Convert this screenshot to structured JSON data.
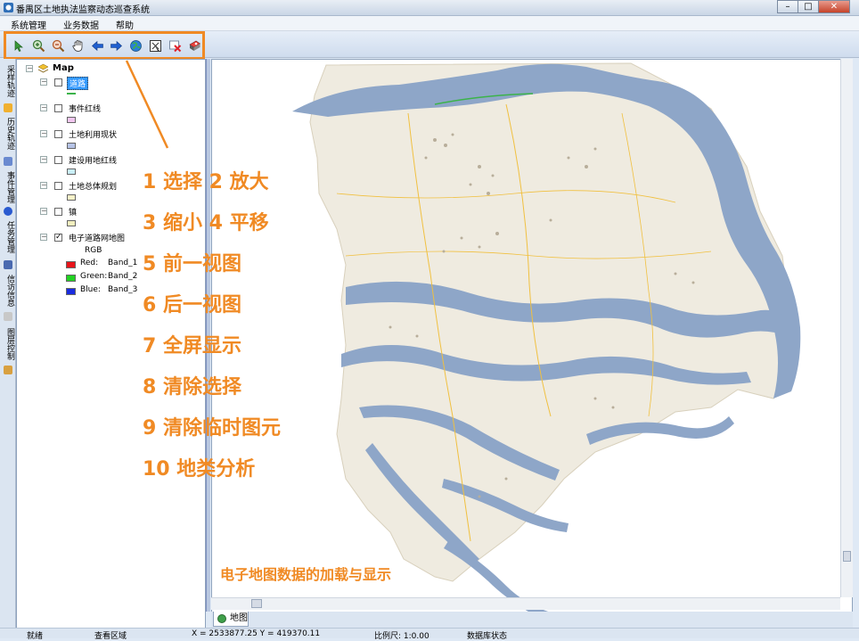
{
  "window": {
    "title": "番禺区土地执法监察动态巡查系统",
    "minimize": "–",
    "maximize": "□",
    "close": "✕"
  },
  "menu": [
    "系统管理",
    "业务数据",
    "帮助"
  ],
  "toolbar": [
    {
      "name": "select-tool-icon"
    },
    {
      "name": "zoom-in-icon"
    },
    {
      "name": "zoom-out-icon"
    },
    {
      "name": "pan-hand-icon"
    },
    {
      "name": "previous-view-icon"
    },
    {
      "name": "next-view-icon"
    },
    {
      "name": "full-extent-globe-icon"
    },
    {
      "name": "clear-selection-icon"
    },
    {
      "name": "clear-temp-graphics-icon"
    },
    {
      "name": "land-type-analysis-icon"
    }
  ],
  "sidebar_tabs": [
    "采样轨迹",
    "历史轨迹",
    "事件管理",
    "任务管理",
    "信访信息",
    "图层控制"
  ],
  "layers": {
    "root": "Map",
    "items": [
      {
        "label": "道路",
        "checked": false,
        "symbol": "line",
        "color": "#3cb34a"
      },
      {
        "label": "事件红线",
        "checked": false,
        "symbol": "fill",
        "color": "#f2c6f0"
      },
      {
        "label": "土地利用现状",
        "checked": false,
        "symbol": "fill",
        "color": "#b6c3e6"
      },
      {
        "label": "建设用地红线",
        "checked": false,
        "symbol": "fill",
        "color": "#c9eef7"
      },
      {
        "label": "土地总体规划",
        "checked": false,
        "symbol": "fill",
        "color": "#f6f1c8"
      },
      {
        "label": "镇",
        "checked": false,
        "symbol": "fill",
        "color": "#f2efbf"
      },
      {
        "label": "电子道路网地图",
        "checked": true,
        "symbol": "raster"
      }
    ],
    "raster": {
      "mode": "RGB",
      "bands": [
        {
          "label": "Red:",
          "band": "Band_1",
          "color": "#e8141a"
        },
        {
          "label": "Green:",
          "band": "Band_2",
          "color": "#22d222"
        },
        {
          "label": "Blue:",
          "band": "Band_3",
          "color": "#1a2ce0"
        }
      ]
    }
  },
  "callouts": [
    "1 选择 2 放大",
    "3 缩小 4 平移",
    "5 前一视图",
    "6 后一视图",
    "7 全屏显示",
    "8 清除选择",
    "9 清除临时图元",
    "10 地类分析"
  ],
  "caption": "电子地图数据的加载与显示",
  "map_tab": "地图",
  "status": {
    "ready": "就绪",
    "query": "查看区域",
    "coords": "X = 2533877.25   Y = 419370.11",
    "scale": "比例尺: 1:0.00",
    "db": "数据库状态"
  },
  "colors": {
    "accent": "#f08a24",
    "land": "#efebe0",
    "water": "#8ea6c8",
    "road_yellow": "#f0c040"
  }
}
